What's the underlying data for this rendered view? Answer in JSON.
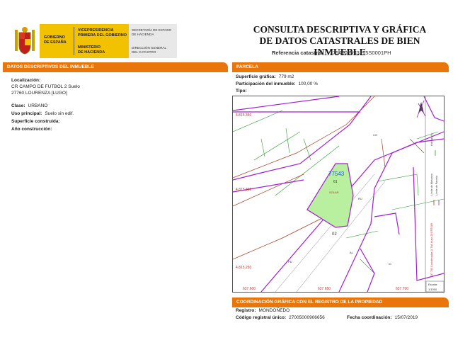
{
  "header": {
    "gobierno": [
      "GOBIERNO",
      "DE ESPAÑA"
    ],
    "vicepresidencia": [
      "VICEPRESIDENCIA",
      "PRIMERA DEL GOBIERNO"
    ],
    "ministerio": [
      "MINISTERIO",
      "DE HACIENDA"
    ],
    "secretaria": [
      "SECRETARÍA DE ESTADO",
      "DE HACIENDA"
    ],
    "direccion": [
      "DIRECCIÓN GENERAL",
      "DEL CATASTRO"
    ],
    "title_line1": "CONSULTA DESCRIPTIVA Y GRÁFICA",
    "title_line2": "DE DATOS CATASTRALES DE BIEN INMUEBLE",
    "ref_label": "Referencia catastral:",
    "ref_value": "7754001PJ3175S0001PH"
  },
  "inmueble": {
    "heading": "DATOS DESCRIPTIVOS DEL INMUEBLE",
    "localizacion_label": "Localización:",
    "localizacion_line1": "CR CAMPO DE FUTBOL 2 Suelo",
    "localizacion_line2": "27760 LOURENZA [LUGO]",
    "clase_label": "Clase:",
    "clase_value": "URBANO",
    "uso_label": "Uso principal:",
    "uso_value": "Suelo sin edif.",
    "superficie_label": "Superficie construida:",
    "ano_label": "Año construcción:"
  },
  "parcela": {
    "heading": "PARCELA",
    "sup_label": "Superficie gráfica:",
    "sup_value": "779 m2",
    "part_label": "Participación del inmueble:",
    "part_value": "100,00 %",
    "tipo_label": "Tipo:"
  },
  "map": {
    "parcel_id": "77543",
    "parcel_sub": "61",
    "solar": "SOLAR",
    "y_labels": [
      "4.815.350",
      "4.815.300",
      "4.815.250"
    ],
    "x_labels": [
      "637.600",
      "637.650",
      "637.700"
    ],
    "escala_label": "Escala:",
    "escala_value": "1/1000",
    "legend": [
      "Hidrografía",
      "Límite de Manzana",
      "Límite de Parcela"
    ],
    "side_note": "637.700 Coordenadas U.T.M. Huso 29 ETRS89",
    "labels": [
      "02",
      "CO",
      "PD",
      "SOLAR",
      "RU",
      "AL",
      "IC"
    ]
  },
  "registro": {
    "heading": "COORDINACIÓN GRÁFICA CON EL REGISTRO DE LA PROPIEDAD",
    "registro_label": "Registro:",
    "registro_value": "MONDOÑEDO",
    "codigo_label": "Código registral único:",
    "codigo_value": "27005000906656",
    "fecha_label": "Fecha coordinación:",
    "fecha_value": "15/07/2019"
  },
  "colors": {
    "orange": "#e8760a",
    "purple": "#a020d0",
    "green": "#b9f0a0",
    "brown": "#a04020"
  }
}
